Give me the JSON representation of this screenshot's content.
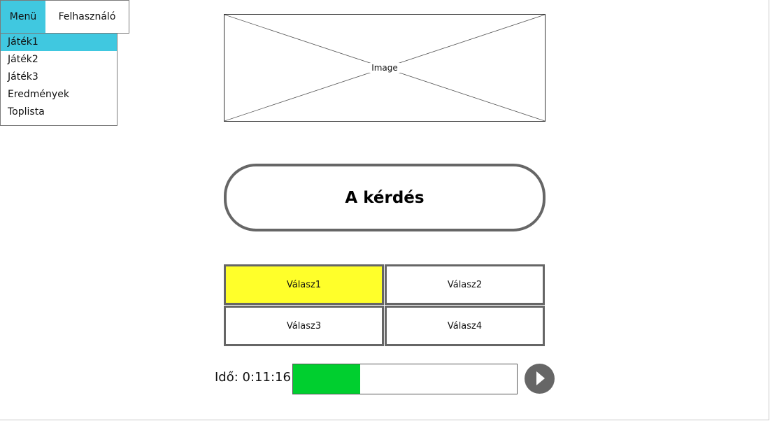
{
  "colors": {
    "accent": "#40c8e0",
    "highlight": "#ffff2a",
    "progress": "#00cf2f"
  },
  "menu": {
    "tabs": [
      {
        "label": "Menü",
        "active": true
      },
      {
        "label": "Felhasználó",
        "active": false
      }
    ],
    "dropdown": [
      {
        "label": "Játék1",
        "selected": true
      },
      {
        "label": "Játék2",
        "selected": false
      },
      {
        "label": "Játék3",
        "selected": false
      },
      {
        "label": "Eredmények",
        "selected": false
      },
      {
        "label": "Toplista",
        "selected": false
      }
    ]
  },
  "image_placeholder": {
    "label": "Image"
  },
  "question": {
    "text": "A kérdés"
  },
  "answers": [
    {
      "label": "Válasz1",
      "highlighted": true
    },
    {
      "label": "Válasz2",
      "highlighted": false
    },
    {
      "label": "Válasz3",
      "highlighted": false
    },
    {
      "label": "Válasz4",
      "highlighted": false
    }
  ],
  "timer": {
    "label": "Idő: 0:11:16",
    "progress_fraction": 0.3,
    "play_icon": "play-icon"
  }
}
